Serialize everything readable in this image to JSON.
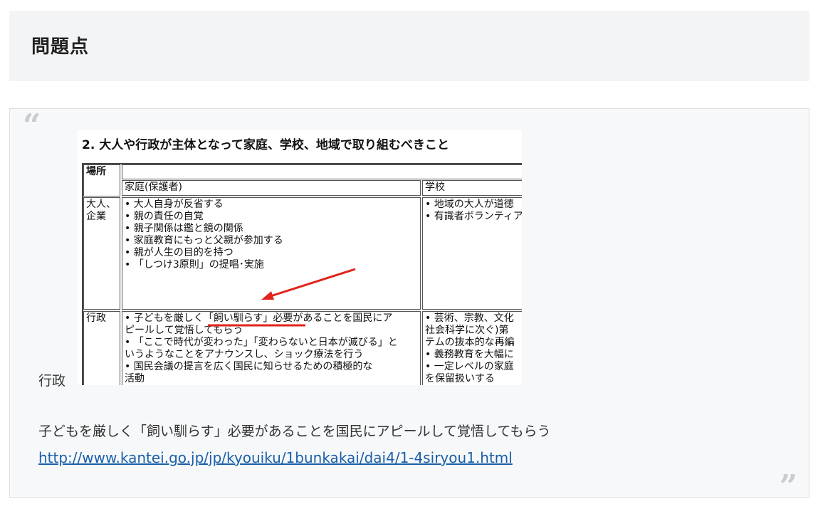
{
  "section": {
    "heading": "問題点"
  },
  "quote": {
    "open_mark": "“",
    "close_mark": "”",
    "caption_label": "行政",
    "text": "子どもを厳しく「飼い馴らす」必要があることを国民にアピールして覚悟してもらう",
    "link_text": "http://www.kantei.go.jp/jp/kyouiku/1bunkakai/dai4/1-4siryou1.html",
    "link_color": "#1a5fa8"
  },
  "embedded_image": {
    "title": "2. 大人や行政が主体となって家庭、学校、地域で取り組むべきこと",
    "header_place": "場所",
    "col_home": "家庭(保護者)",
    "col_school": "学校",
    "row_adults_label": "大人、企業",
    "row_admin_label": "行政",
    "adults_home": [
      "• 大人自身が反省する",
      "• 親の責任の自覚",
      "• 親子関係は鑑と鏡の関係",
      "• 家庭教育にもっと父親が参加する",
      "• 親が人生の目的を持つ",
      "• 「しつけ3原則」の提唱･実施"
    ],
    "adults_school": [
      "• 地域の大人が道徳",
      "• 有識者ボランティア"
    ],
    "admin_home": [
      "• 子どもを厳しく「飼い馴らす」必要があることを国民にア",
      "ピールして覚悟してもらう",
      "• 「ここで時代が変わった」「変わらないと日本が滅びる」と",
      "いうようなことをアナウンスし、ショック療法を行う",
      "• 国民会議の提言を広く国民に知らせるための積極的な",
      "活動"
    ],
    "admin_school": [
      "• 芸術、宗教、文化",
      "社会科学に次ぐ)第",
      "テムの抜本的な再編",
      "• 義務教育を大幅に",
      "• 一定レベルの家庭",
      "を保留扱いする"
    ],
    "arrow_color": "#e0241b"
  }
}
